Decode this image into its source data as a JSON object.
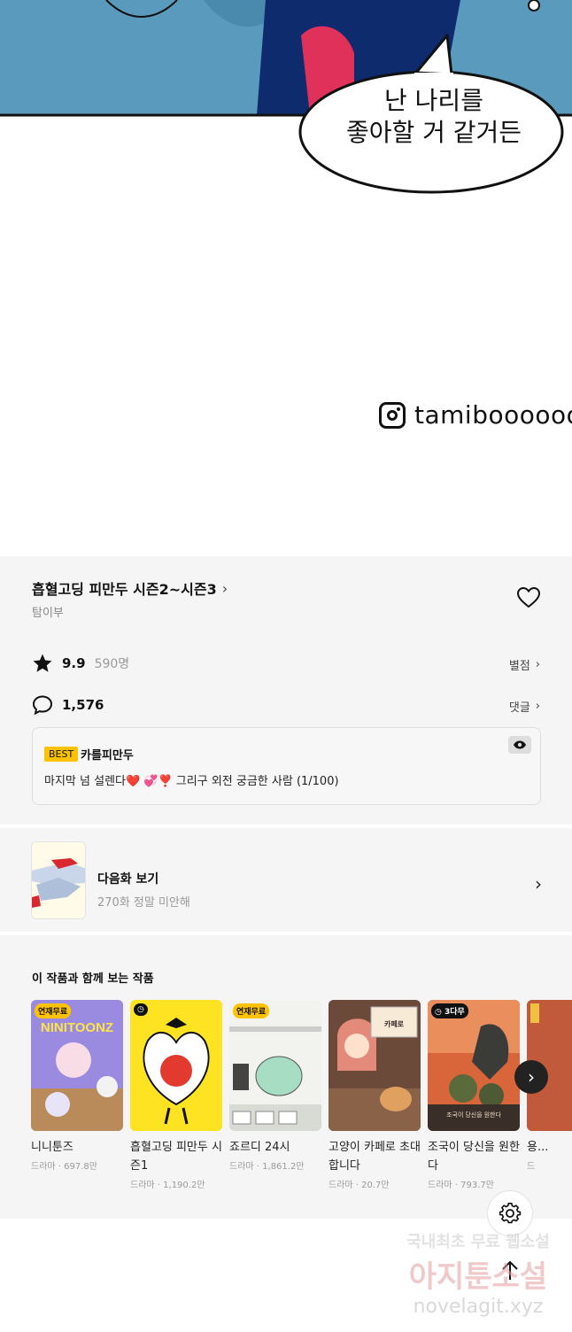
{
  "comic": {
    "speech_line1": "난 나리를",
    "speech_line2": "좋아할 거 같거든",
    "instagram_handle": "tamiboooooo"
  },
  "work": {
    "title": "흡혈고딩 피만두 시즌2~시즌3",
    "author": "탐이부"
  },
  "rating": {
    "score": "9.9",
    "count": "590명",
    "link": "별점"
  },
  "comments": {
    "count": "1,576",
    "link": "댓글"
  },
  "best_comment": {
    "badge": "BEST",
    "user": "카를피만두",
    "text": "마지막 넘 설렌다❤️ 💞❣️ 그리구 외전 궁금한 사람 (1/100)"
  },
  "next_episode": {
    "label": "다음화 보기",
    "subtitle": "270화 정말 미안해"
  },
  "recommendations": {
    "heading": "이 작품과 함께 보는 작품",
    "items": [
      {
        "title": "니니툰즈",
        "genre": "드라마",
        "views": "697.8만",
        "badge": "연재무료",
        "badge_type": "free",
        "thumb_text": "NINITOONZ"
      },
      {
        "title": "흡혈고딩 피만두 시즌1",
        "genre": "드라마",
        "views": "1,190.2만",
        "badge": "",
        "badge_type": "clock",
        "thumb_text": ""
      },
      {
        "title": "죠르디 24시",
        "genre": "드라마",
        "views": "1,861.2만",
        "badge": "연재무료",
        "badge_type": "free",
        "thumb_text": ""
      },
      {
        "title": "고양이 카페로 초대합니다",
        "genre": "드라마",
        "views": "20.7만",
        "badge": "",
        "badge_type": "none",
        "thumb_text": "고양이 카페로 초대합니다."
      },
      {
        "title": "조국이 당신을 원한다",
        "genre": "드라마",
        "views": "793.7만",
        "badge": "3다무",
        "badge_type": "clock",
        "thumb_text": ""
      },
      {
        "title": "용...",
        "genre": "드",
        "views": "",
        "badge": "",
        "badge_type": "none",
        "thumb_text": ""
      }
    ]
  },
  "watermark": {
    "line1": "국내최초 무료 웹소설",
    "line2": "아지툰소설",
    "line3": "novelagit.xyz"
  }
}
